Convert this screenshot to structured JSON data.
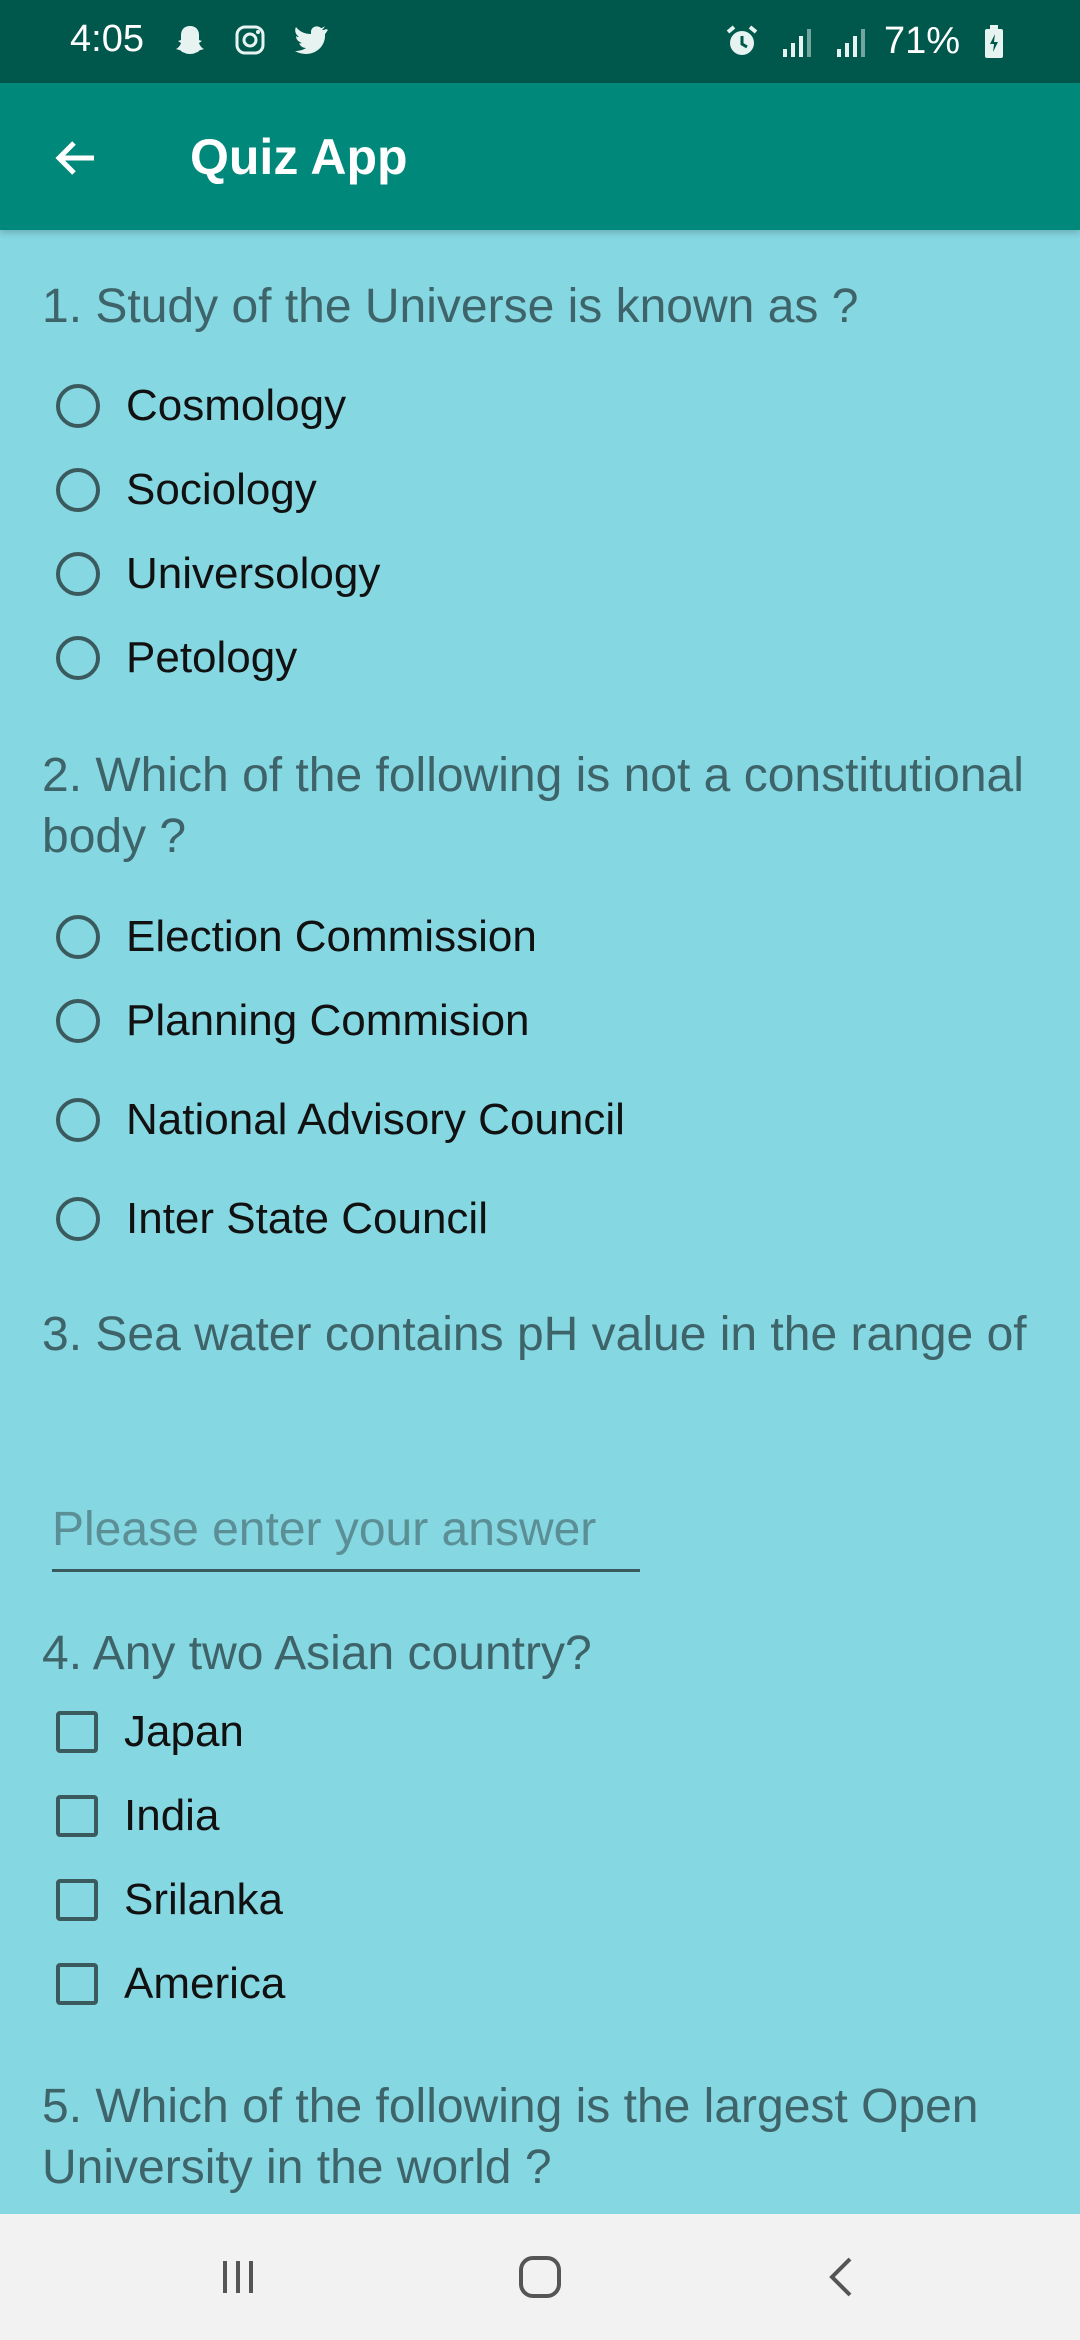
{
  "status_bar": {
    "time": "4:05",
    "battery": "71%",
    "icons_left": [
      "snapchat-icon",
      "instagram-icon",
      "twitter-icon"
    ],
    "icons_right": [
      "alarm-icon",
      "signal-icon",
      "signal-icon",
      "battery-icon"
    ]
  },
  "app_bar": {
    "title": "Quiz App",
    "back_icon": "arrow-left-icon",
    "color": "#00887a"
  },
  "colors": {
    "background": "#85d7e2",
    "status_bar": "#00574b",
    "question_text": "#3e646a"
  },
  "questions": [
    {
      "text": "1. Study of the Universe is known as ?",
      "type": "radio",
      "options": [
        "Cosmology",
        "Sociology",
        "Universology",
        "Petology"
      ]
    },
    {
      "text": "2. Which of the following is not a constitutional body ?",
      "type": "radio",
      "options": [
        "Election Commission",
        "Planning Commision",
        "National Advisory Council",
        "Inter State Council"
      ]
    },
    {
      "text": "3. Sea water contains pH value in the range of",
      "type": "text",
      "answer": "",
      "placeholder": "Please enter your answer"
    },
    {
      "text": "4. Any two Asian country?",
      "type": "checkbox",
      "options": [
        "Japan",
        "India",
        "Srilanka",
        "America"
      ]
    },
    {
      "text": "5. Which of the following is the largest Open University in the world ?",
      "type": "radio",
      "options": []
    }
  ],
  "nav_bar": {
    "buttons": [
      "recent-apps-icon",
      "home-icon",
      "back-icon"
    ]
  }
}
